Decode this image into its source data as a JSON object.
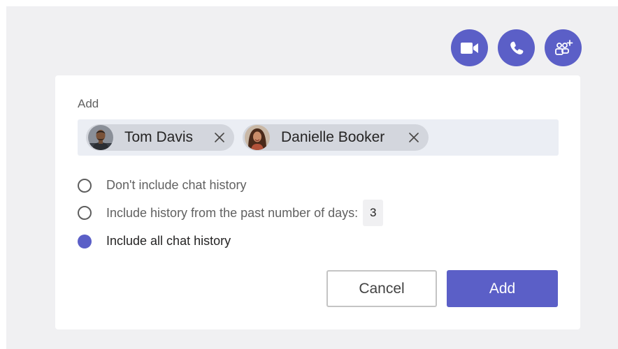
{
  "call_actions": {
    "video_icon": "video-camera-icon",
    "audio_icon": "phone-icon",
    "add_people_icon": "add-people-icon",
    "accent": "#5b5fc7"
  },
  "dialog": {
    "label": "Add",
    "people": [
      {
        "name": "Tom Davis",
        "avatar": "tom-davis-photo"
      },
      {
        "name": "Danielle Booker",
        "avatar": "danielle-booker-photo"
      }
    ],
    "history_options": [
      {
        "label": "Don't include chat history",
        "selected": false
      },
      {
        "label": "Include history from the past number of days:",
        "selected": false,
        "days": "3"
      },
      {
        "label": "Include all chat history",
        "selected": true
      }
    ],
    "buttons": {
      "cancel": "Cancel",
      "add": "Add"
    }
  }
}
